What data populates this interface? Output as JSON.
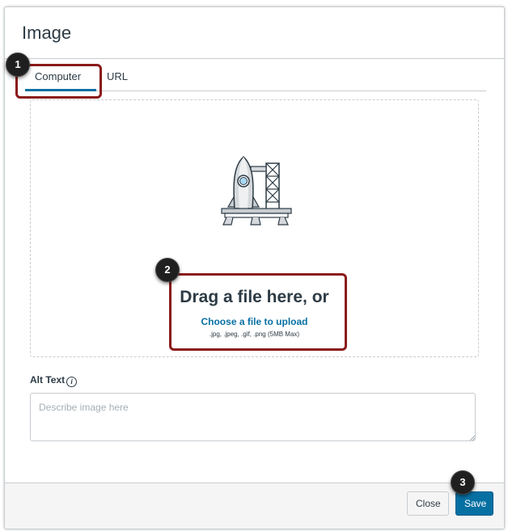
{
  "dialog": {
    "title": "Image"
  },
  "tabs": [
    {
      "label": "Computer",
      "active": true
    },
    {
      "label": "URL",
      "active": false
    }
  ],
  "dropzone": {
    "drag_text": "Drag a file here, or",
    "choose_text": "Choose a file to upload",
    "formats_text": ".jpg, .jpeg, .gif, .png (5MB Max)",
    "illustration": "rocket-launch-icon"
  },
  "alt_text": {
    "label": "Alt Text",
    "info_icon": "i",
    "placeholder": "Describe image here",
    "value": ""
  },
  "footer": {
    "close_label": "Close",
    "save_label": "Save"
  },
  "callouts": [
    "1",
    "2",
    "3"
  ],
  "colors": {
    "accent": "#0770a3",
    "callout_border": "#8b1a1a",
    "text": "#2d3b45",
    "border": "#c7cdd1"
  }
}
